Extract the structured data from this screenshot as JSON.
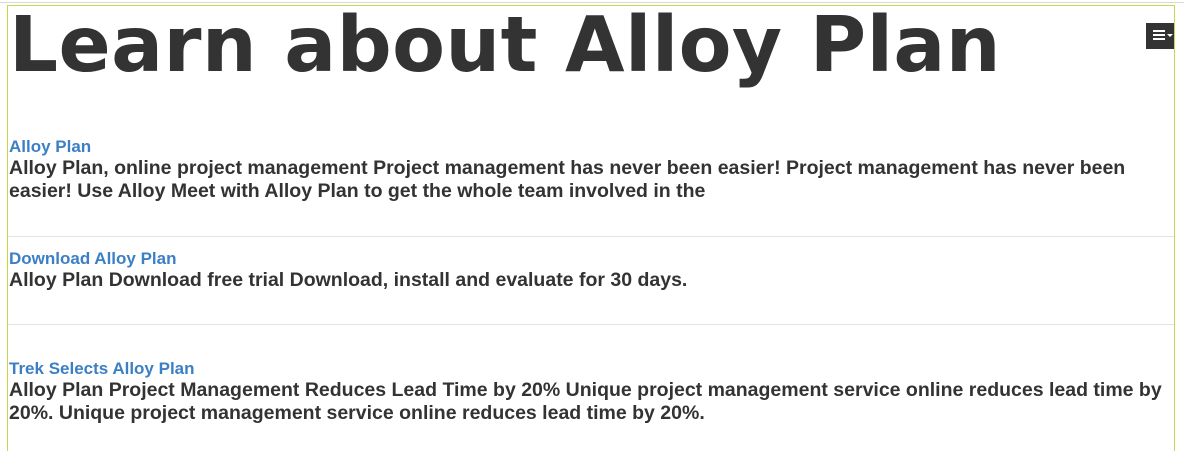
{
  "heading": "Learn about Alloy Plan",
  "menu_button": {
    "icon": "menu-caret-icon"
  },
  "results": [
    {
      "title": "Alloy Plan",
      "description": "Alloy Plan, online project management Project management has never been easier! Project management has never been easier! Use Alloy Meet with Alloy Plan to get the whole team involved in the"
    },
    {
      "title": "Download Alloy Plan",
      "description": "Alloy Plan Download free trial Download, install and evaluate for 30 days."
    },
    {
      "title": "Trek Selects Alloy Plan",
      "description": "Alloy Plan Project Management Reduces Lead Time by 20% Unique project management service online reduces lead time by 20%. Unique project management service online reduces lead time by 20%."
    }
  ],
  "colors": {
    "link": "#3b7fc4",
    "text": "#333333",
    "widget_border": "#c8d84a"
  }
}
